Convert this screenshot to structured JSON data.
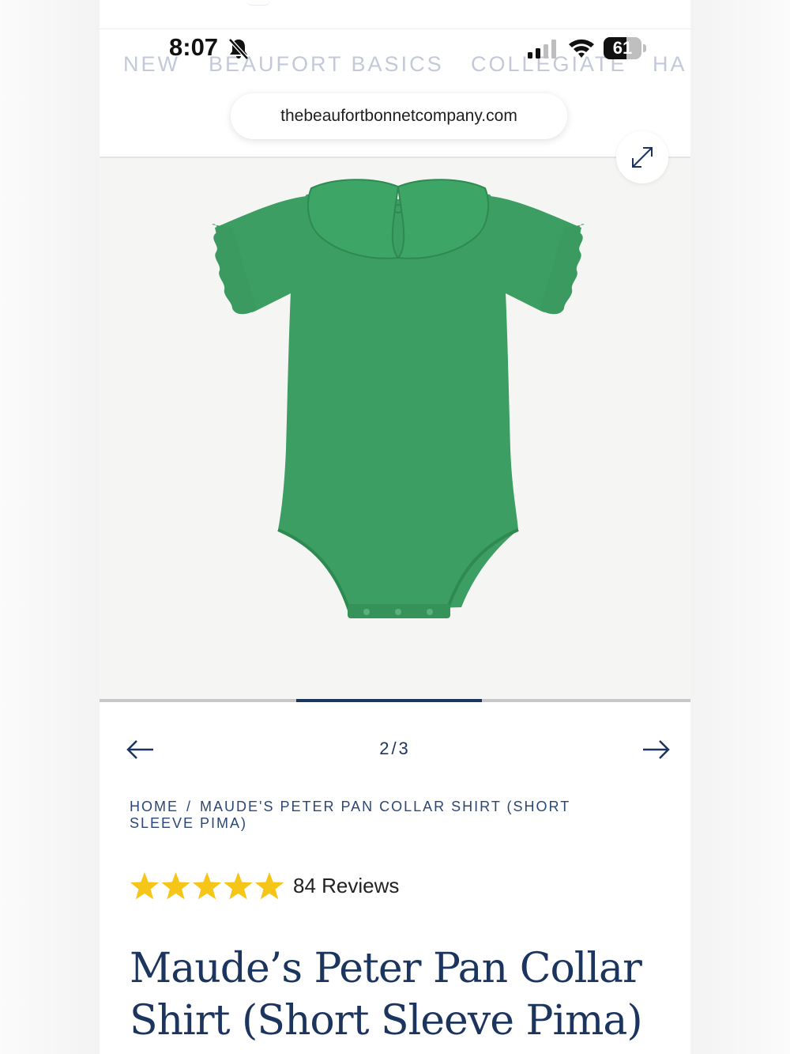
{
  "status_bar": {
    "time": "8:07",
    "battery": "61",
    "icons": [
      "bell-slash-icon",
      "cellular-signal-icon",
      "wifi-icon",
      "battery-icon"
    ]
  },
  "nav": {
    "items": [
      "NEW",
      "BEAUFORT BASICS",
      "COLLEGIATE",
      "HA"
    ]
  },
  "browser": {
    "url": "thebeaufortbonnetcompany.com"
  },
  "gallery": {
    "counter": "2/3",
    "current": 2,
    "total": 3,
    "garment_color": "#3c9e63",
    "icons": [
      "expand-icon",
      "arrow-left-icon",
      "arrow-right-icon"
    ]
  },
  "breadcrumb": {
    "home": "HOME",
    "separator": "/",
    "current": "MAUDE'S PETER PAN COLLAR SHIRT (SHORT SLEEVE PIMA)"
  },
  "rating": {
    "stars": 5,
    "reviews_label": "84 Reviews",
    "star_color": "#f5c518"
  },
  "product": {
    "title": "Maude’s Peter Pan Collar Shirt (Short Sleeve Pima)"
  },
  "colors": {
    "brand_navy": "#1c355e",
    "nav_text": "#c3c9d8"
  }
}
